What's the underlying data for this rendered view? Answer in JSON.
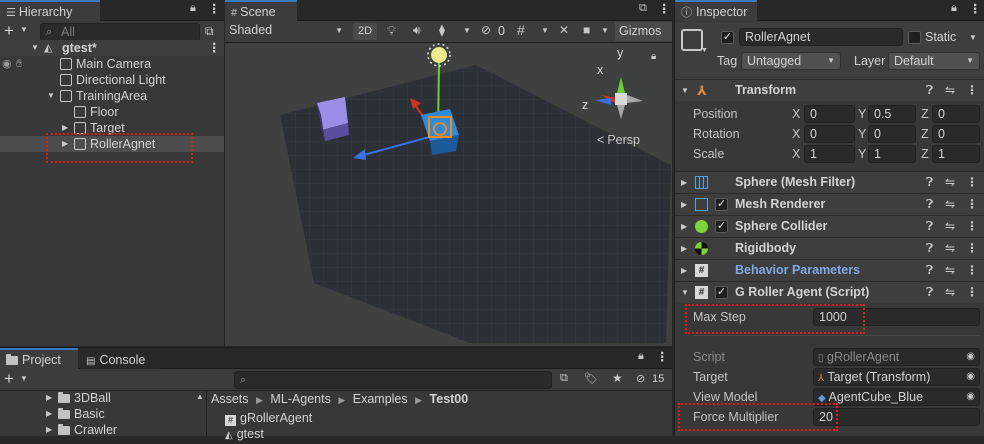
{
  "hierarchy": {
    "tab_label": "Hierarchy",
    "search_placeholder": "All",
    "add_symbol": "+",
    "scene_name": "gtest*",
    "items": [
      {
        "label": "Main Camera"
      },
      {
        "label": "Directional Light"
      },
      {
        "label": "TrainingArea"
      },
      {
        "label": "Floor"
      },
      {
        "label": "Target"
      },
      {
        "label": "RollerAgnet"
      }
    ]
  },
  "scene": {
    "tab_label": "Scene",
    "shading_mode": "Shaded",
    "mode_2d": "2D",
    "hidden_count": "0",
    "gizmos_label": "Gizmos",
    "gizmo_axis_x": "x",
    "gizmo_axis_y": "y",
    "gizmo_axis_z": "z",
    "persp_label": "Persp"
  },
  "inspector": {
    "tab_label": "Inspector",
    "object_name": "RollerAgnet",
    "static_label": "Static",
    "tag_label": "Tag",
    "tag_value": "Untagged",
    "layer_label": "Layer",
    "layer_value": "Default",
    "transform": {
      "title": "Transform",
      "rows": [
        {
          "label": "Position",
          "x": "0",
          "y": "0.5",
          "z": "0"
        },
        {
          "label": "Rotation",
          "x": "0",
          "y": "0",
          "z": "0"
        },
        {
          "label": "Scale",
          "x": "1",
          "y": "1",
          "z": "1"
        }
      ],
      "axis_x": "X",
      "axis_y": "Y",
      "axis_z": "Z"
    },
    "components": [
      {
        "title": "Sphere (Mesh Filter)",
        "checkbox": false
      },
      {
        "title": "Mesh Renderer",
        "checkbox": true
      },
      {
        "title": "Sphere Collider",
        "checkbox": true
      },
      {
        "title": "Rigidbody",
        "checkbox": false
      },
      {
        "title": "Behavior Parameters",
        "checkbox": false
      },
      {
        "title": "G Roller Agent (Script)",
        "checkbox": true
      }
    ],
    "agent": {
      "max_step_label": "Max Step",
      "max_step_value": "1000",
      "script_label": "Script",
      "script_value": "gRollerAgent",
      "target_label": "Target",
      "target_value": "Target (Transform)",
      "view_model_label": "View Model",
      "view_model_value": "AgentCube_Blue",
      "force_label": "Force Multiplier",
      "force_value": "20"
    }
  },
  "project": {
    "tab_project": "Project",
    "tab_console": "Console",
    "add_symbol": "+",
    "hidden_count": "15",
    "folders": [
      {
        "label": "3DBall"
      },
      {
        "label": "Basic"
      },
      {
        "label": "Crawler"
      }
    ],
    "breadcrumb": [
      "Assets",
      "ML-Agents",
      "Examples",
      "Test00"
    ],
    "files": [
      {
        "label": "gRollerAgent"
      },
      {
        "label": "gtest"
      }
    ]
  },
  "colors": {
    "accent": "#3a79bb",
    "highlight_box": "#e01b1b",
    "behavior_params": "#7fa8e6"
  }
}
